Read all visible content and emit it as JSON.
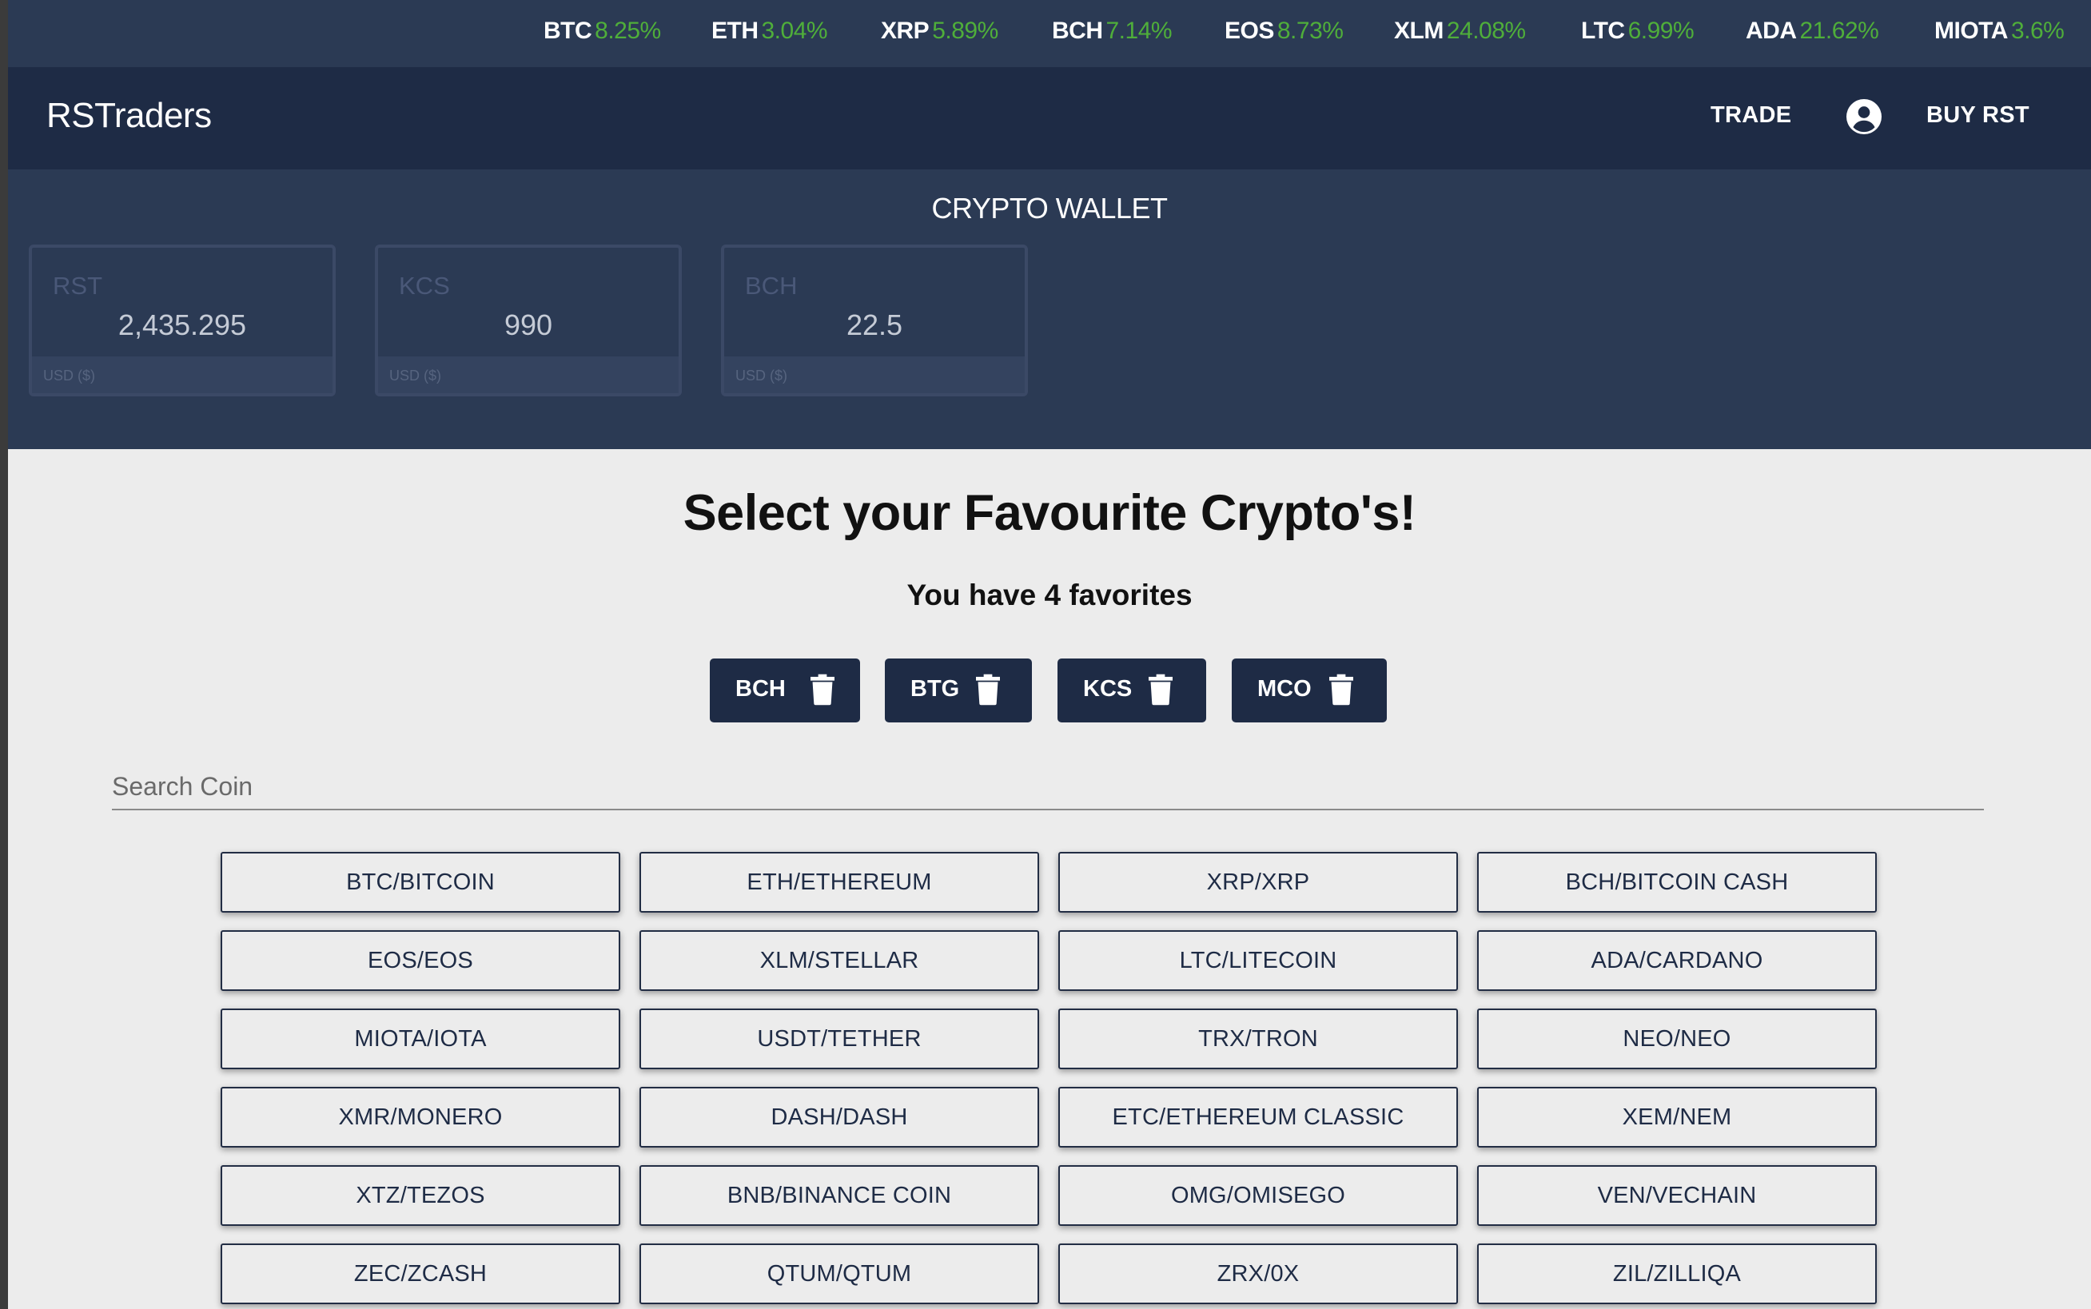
{
  "ticker": [
    {
      "symbol": "BTC",
      "change": "8.25%"
    },
    {
      "symbol": "ETH",
      "change": "3.04%"
    },
    {
      "symbol": "XRP",
      "change": "5.89%"
    },
    {
      "symbol": "BCH",
      "change": "7.14%"
    },
    {
      "symbol": "EOS",
      "change": "8.73%"
    },
    {
      "symbol": "XLM",
      "change": "24.08%"
    },
    {
      "symbol": "LTC",
      "change": "6.99%"
    },
    {
      "symbol": "ADA",
      "change": "21.62%"
    },
    {
      "symbol": "MIOTA",
      "change": "3.6%"
    }
  ],
  "nav": {
    "brand": "RSTraders",
    "trade": "TRADE",
    "buy": "BUY RST",
    "account_icon": "account-circle-icon"
  },
  "wallet": {
    "title": "CRYPTO WALLET",
    "cards": [
      {
        "symbol": "RST",
        "value": "2,435.295",
        "footer": "USD ($)"
      },
      {
        "symbol": "KCS",
        "value": "990",
        "footer": "USD ($)"
      },
      {
        "symbol": "BCH",
        "value": "22.5",
        "footer": "USD ($)"
      }
    ]
  },
  "favorites": {
    "title": "Select your Favourite Crypto's!",
    "count_text": "You have 4 favorites",
    "items": [
      {
        "label": "BCH",
        "icon": "trash-icon"
      },
      {
        "label": "BTG",
        "icon": "trash-icon"
      },
      {
        "label": "KCS",
        "icon": "trash-icon"
      },
      {
        "label": "MCO",
        "icon": "trash-icon"
      }
    ]
  },
  "search": {
    "placeholder": "Search Coin",
    "value": ""
  },
  "coins": [
    "BTC/BITCOIN",
    "ETH/ETHEREUM",
    "XRP/XRP",
    "BCH/BITCOIN CASH",
    "EOS/EOS",
    "XLM/STELLAR",
    "LTC/LITECOIN",
    "ADA/CARDANO",
    "MIOTA/IOTA",
    "USDT/TETHER",
    "TRX/TRON",
    "NEO/NEO",
    "XMR/MONERO",
    "DASH/DASH",
    "ETC/ETHEREUM CLASSIC",
    "XEM/NEM",
    "XTZ/TEZOS",
    "BNB/BINANCE COIN",
    "OMG/OMISEGO",
    "VEN/VECHAIN",
    "ZEC/ZCASH",
    "QTUM/QTUM",
    "ZRX/0X",
    "ZIL/ZILLIQA"
  ],
  "colors": {
    "navy": "#1e2b45",
    "header_blue": "#2b3a54",
    "positive_green": "#4fae3a",
    "page_bg": "#ececec"
  }
}
